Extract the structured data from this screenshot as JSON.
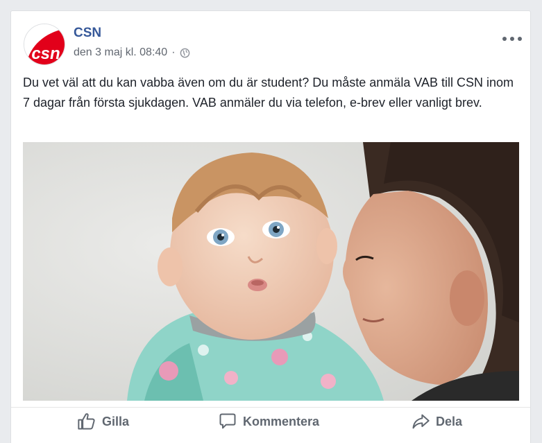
{
  "post": {
    "page_name": "CSN",
    "date": "den 3 maj kl. 08:40",
    "separator": "·",
    "audience_icon": "globe-icon",
    "menu_icon": "more-options-icon",
    "text": "Du vet väl att du kan vabba även om du är student? Du måste anmäla VAB till CSN inom 7 dagar från första sjukdagen. VAB anmäler du via telefon, e-brev eller vanligt brev.",
    "avatar_logo_text": "csn",
    "brand_color": "#e2001a"
  },
  "actions": {
    "like": {
      "label": "Gilla",
      "icon": "thumbs-up-icon"
    },
    "comment": {
      "label": "Kommentera",
      "icon": "comment-bubble-icon"
    },
    "share": {
      "label": "Dela",
      "icon": "share-arrow-icon"
    }
  },
  "colors": {
    "link": "#365899",
    "meta": "#616770",
    "text": "#1d2129",
    "action": "#606770"
  }
}
